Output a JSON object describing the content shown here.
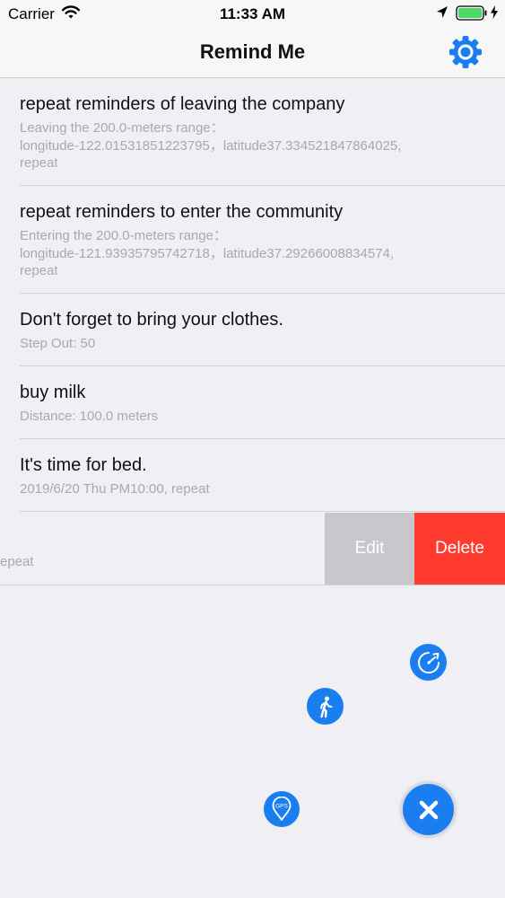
{
  "status_bar": {
    "carrier": "Carrier",
    "time": "11:33 AM"
  },
  "nav": {
    "title": "Remind Me",
    "settings_icon": "gear-icon"
  },
  "reminders": [
    {
      "title": "repeat reminders of leaving the company",
      "lines": [
        "Leaving the 200.0-meters range：",
        "longitude-122.01531851223795，latitude37.334521847864025,",
        "repeat"
      ]
    },
    {
      "title": "repeat reminders to enter the community",
      "lines": [
        "Entering the 200.0-meters range：",
        "longitude-121.93935795742718，latitude37.29266008834574,",
        "repeat"
      ]
    },
    {
      "title": "Don't forget to bring your clothes.",
      "lines": [
        "Step Out: 50"
      ]
    },
    {
      "title": "buy milk",
      "lines": [
        "Distance: 100.0 meters"
      ]
    },
    {
      "title": "It's time for bed.",
      "lines": [
        "2019/6/20 Thu PM10:00, repeat"
      ]
    }
  ],
  "swiped_row": {
    "visible_text": "epeat",
    "edit_label": "Edit",
    "delete_label": "Delete"
  },
  "fab_menu": {
    "timer_icon": "timer-icon",
    "walk_icon": "walking-icon",
    "gps_icon": "gps-pin-icon",
    "gps_label": "GPS",
    "close_icon": "close-icon"
  },
  "colors": {
    "accent": "#1a7df0",
    "delete": "#ff3b30",
    "edit": "#c7c7cc",
    "background": "#efeff4"
  }
}
